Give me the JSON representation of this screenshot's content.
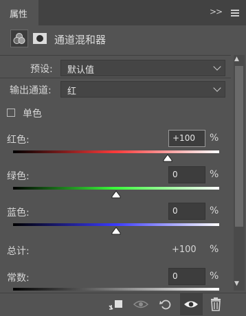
{
  "panel": {
    "tab_label": "属性",
    "collapse_glyph": ">>",
    "title": "通道混和器"
  },
  "preset": {
    "label": "预设:",
    "value": "默认值"
  },
  "output_channel": {
    "label": "输出通道:",
    "value": "红"
  },
  "monochrome": {
    "label": "单色",
    "checked": false
  },
  "sliders": [
    {
      "label": "红色:",
      "value": "+100",
      "unit": "%",
      "level_percent": 100,
      "colors": [
        "#000000",
        "#ff3b3b",
        "#ffffff"
      ]
    },
    {
      "label": "绿色:",
      "value": "0",
      "unit": "%",
      "level_percent": 0,
      "colors": [
        "#000000",
        "#3cff3c",
        "#ffffff"
      ]
    },
    {
      "label": "蓝色:",
      "value": "0",
      "unit": "%",
      "level_percent": 0,
      "colors": [
        "#000000",
        "#3b3bff",
        "#ffffff"
      ]
    }
  ],
  "total": {
    "label": "总计:",
    "value": "+100",
    "unit": "%"
  },
  "constant": {
    "label": "常数:",
    "value": "0",
    "unit": "%",
    "level_percent": 0
  },
  "toolbar_icons": [
    "clip-to-layer-icon",
    "toggle-visibility-view-icon",
    "reset-icon",
    "eye-icon",
    "trash-icon"
  ]
}
